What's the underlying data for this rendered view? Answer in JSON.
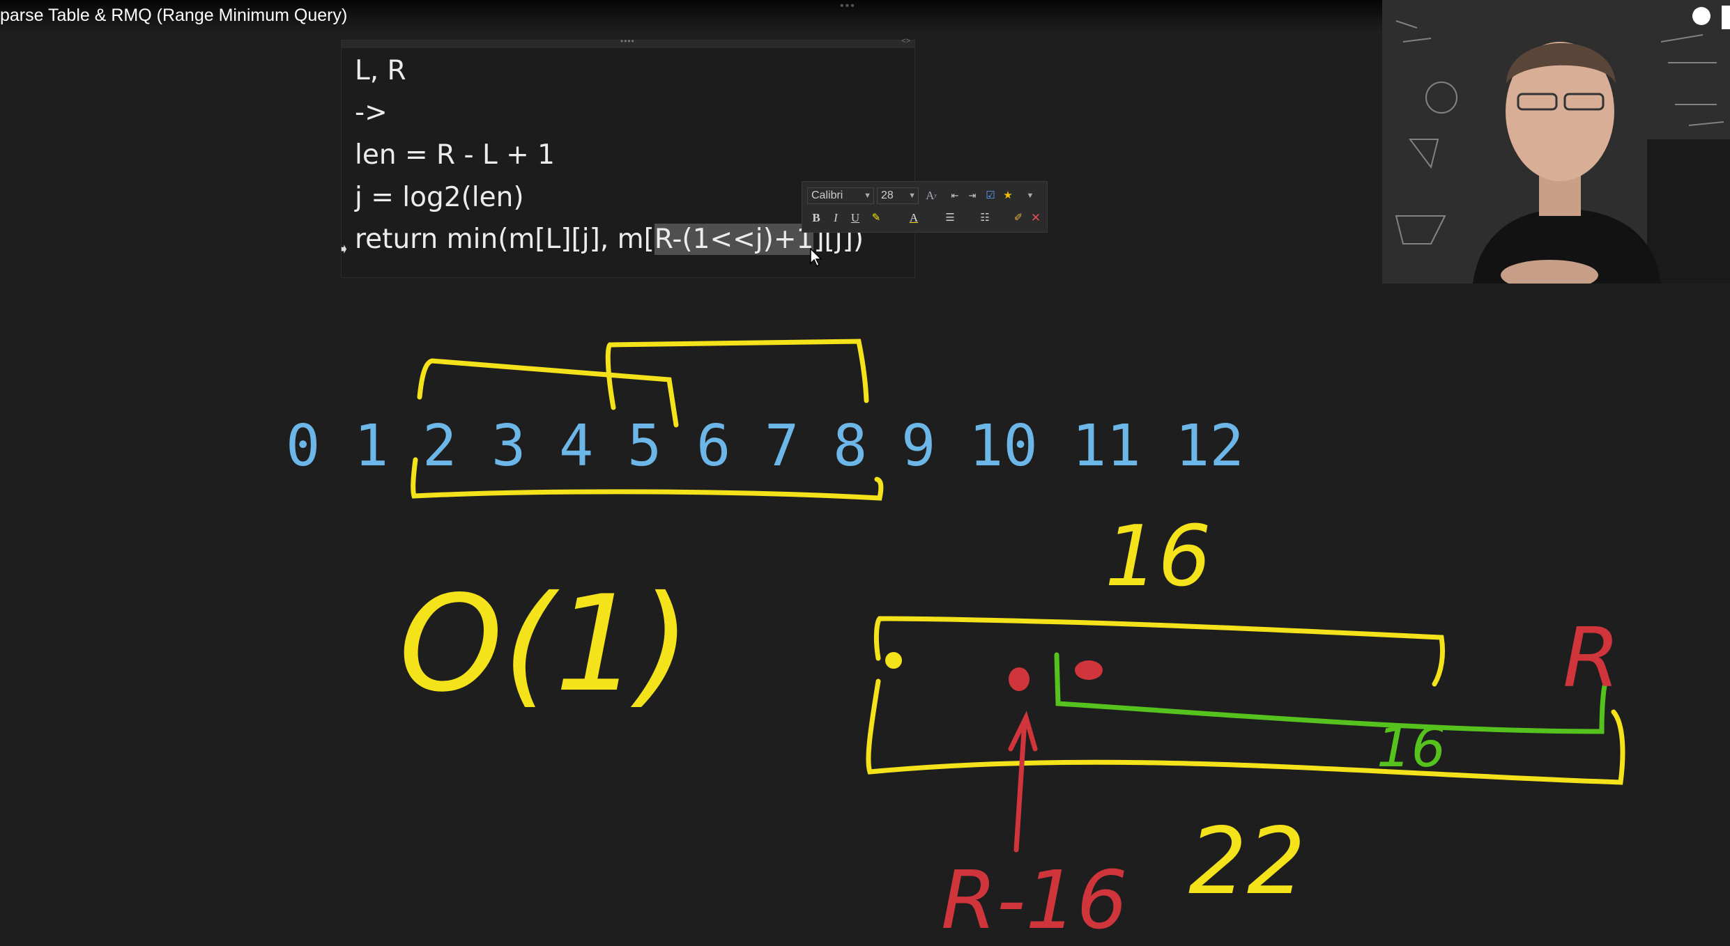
{
  "video": {
    "title": "parse Table & RMQ (Range Minimum Query)"
  },
  "note": {
    "lines": [
      "L, R",
      "->",
      "len = R - L + 1",
      "j = log2(len)"
    ],
    "return_prefix": "return min(m[L][j], m[",
    "return_highlight": "R-(1<<j)+1",
    "return_suffix": "][j])"
  },
  "format_toolbar": {
    "font_name": "Calibri",
    "font_size": "28",
    "buttons": [
      "B",
      "I",
      "U"
    ]
  },
  "whiteboard": {
    "numbers": [
      "0",
      "1",
      "2",
      "3",
      "4",
      "5",
      "6",
      "7",
      "8",
      "9",
      "10",
      "11",
      "12"
    ],
    "complexity": "O(1)",
    "top_length": "16",
    "right_label": "R",
    "green_length": "16",
    "bottom_length": "22",
    "arrow_label": "R-16"
  },
  "colors": {
    "background": "#1e1e1e",
    "numbers": "#6cb6e8",
    "yellow_ink": "#f4e21a",
    "green_ink": "#55c21e",
    "red_ink": "#d0353b"
  }
}
